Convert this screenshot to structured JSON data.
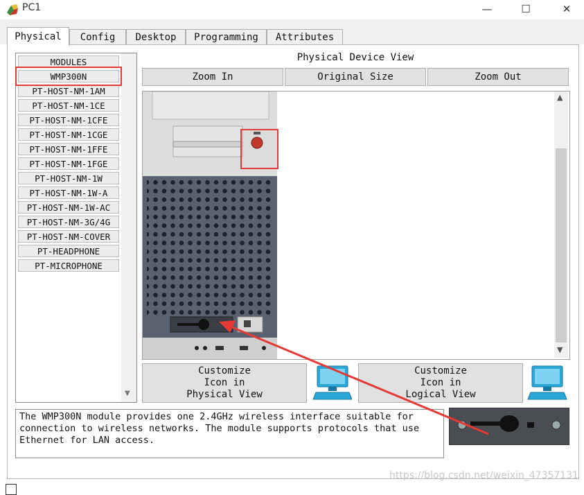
{
  "window": {
    "title": "PC1",
    "minimize_icon": "minimize-icon",
    "maximize_icon": "maximize-icon",
    "close_icon": "close-icon"
  },
  "tabs": [
    {
      "label": "Physical",
      "active": true
    },
    {
      "label": "Config",
      "active": false
    },
    {
      "label": "Desktop",
      "active": false
    },
    {
      "label": "Programming",
      "active": false
    },
    {
      "label": "Attributes",
      "active": false
    }
  ],
  "modules": {
    "items": [
      "MODULES",
      "WMP300N",
      "PT-HOST-NM-1AM",
      "PT-HOST-NM-1CE",
      "PT-HOST-NM-1CFE",
      "PT-HOST-NM-1CGE",
      "PT-HOST-NM-1FFE",
      "PT-HOST-NM-1FGE",
      "PT-HOST-NM-1W",
      "PT-HOST-NM-1W-A",
      "PT-HOST-NM-1W-AC",
      "PT-HOST-NM-3G/4G",
      "PT-HOST-NM-COVER",
      "PT-HEADPHONE",
      "PT-MICROPHONE"
    ],
    "selected": "WMP300N"
  },
  "physical_view": {
    "title": "Physical Device View",
    "zoom_in": "Zoom In",
    "original_size": "Original Size",
    "zoom_out": "Zoom Out"
  },
  "customize": {
    "physical": "Customize\nIcon in\nPhysical View",
    "logical": "Customize\nIcon in\nLogical View"
  },
  "description": "The WMP300N module provides one 2.4GHz wireless interface suitable for\nconnection to wireless networks. The module supports protocols that use\nEthernet for LAN access.",
  "watermark": "https://blog.csdn.net/weixin_47357131",
  "colors": {
    "highlight": "#e53935",
    "pc_case": "#dcdcdc",
    "pc_bottom": "#4b5563",
    "monitor_blue": "#2aa7d8"
  }
}
